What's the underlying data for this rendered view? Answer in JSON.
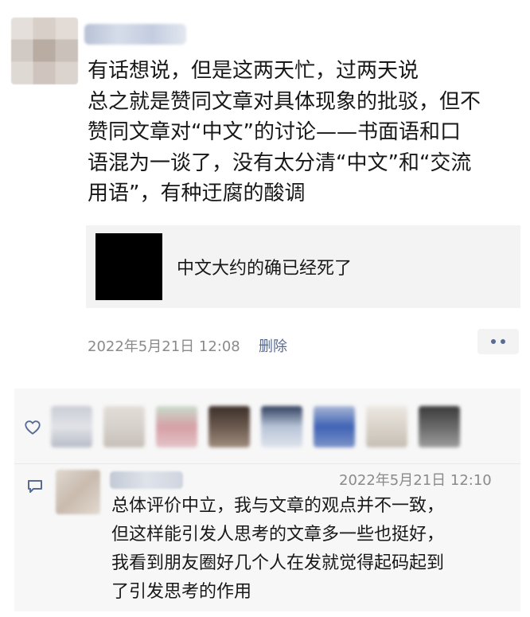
{
  "post": {
    "author": "",
    "text_lines": [
      "有话想说，但是这两天忙，过两天说",
      "总之就是赞同文章对具体现象的批驳，但不",
      "赞同文章对“中文”的讨论——书面语和口",
      "语混为一谈了，没有太分清“中文”和“交流",
      "用语”，有种迂腐的酸调"
    ],
    "shared_link": {
      "title": "中文大约的确已经死了"
    },
    "timestamp": "2022年5月21日 12:08",
    "delete_label": "删除"
  },
  "likes": {
    "icon": "heart-outline-icon",
    "avatar_colors": [
      "#c9cdd6",
      "#d7d1cc",
      "#d6a0a7",
      "#6b5a4f",
      "#b8c4d8",
      "#3f63b5",
      "#d9d3ca",
      "#6a6a6a"
    ]
  },
  "comment": {
    "icon": "comment-icon",
    "author": "",
    "timestamp": "2022年5月21日 12:10",
    "text_lines": [
      "总体评价中立，我与文章的观点并不一致，",
      "但这样能引发人思考的文章多一些也挺好，",
      "我看到朋友圈好几个人在发就觉得起码起到",
      "了引发思考的作用"
    ]
  },
  "colors": {
    "link_blue": "#576b95",
    "meta_gray": "#8a8a8a",
    "card_bg": "#f3f3f3",
    "interaction_bg": "#f7f7f7"
  }
}
